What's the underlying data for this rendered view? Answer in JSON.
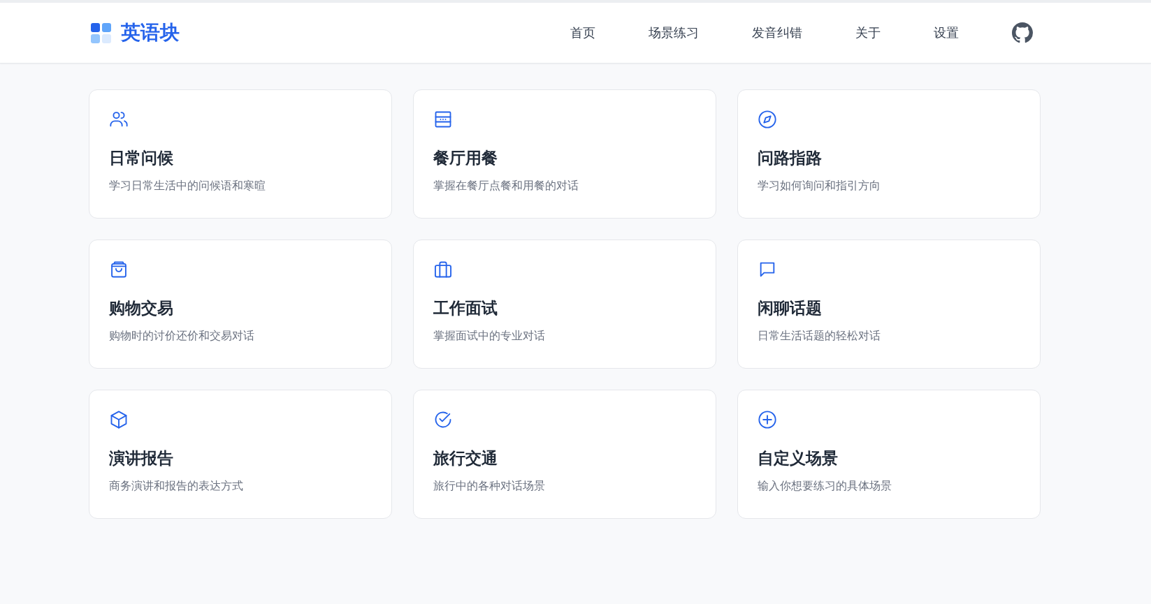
{
  "header": {
    "logo_text": "英语块",
    "nav": [
      {
        "label": "首页"
      },
      {
        "label": "场景练习"
      },
      {
        "label": "发音纠错"
      },
      {
        "label": "关于"
      },
      {
        "label": "设置"
      }
    ]
  },
  "scenes": [
    {
      "title": "日常问候",
      "description": "学习日常生活中的问候语和寒暄"
    },
    {
      "title": "餐厅用餐",
      "description": "掌握在餐厅点餐和用餐的对话"
    },
    {
      "title": "问路指路",
      "description": "学习如何询问和指引方向"
    },
    {
      "title": "购物交易",
      "description": "购物时的讨价还价和交易对话"
    },
    {
      "title": "工作面试",
      "description": "掌握面试中的专业对话"
    },
    {
      "title": "闲聊话题",
      "description": "日常生活话题的轻松对话"
    },
    {
      "title": "演讲报告",
      "description": "商务演讲和报告的表达方式"
    },
    {
      "title": "旅行交通",
      "description": "旅行中的各种对话场景"
    },
    {
      "title": "自定义场景",
      "description": "输入你想要练习的具体场景"
    }
  ]
}
